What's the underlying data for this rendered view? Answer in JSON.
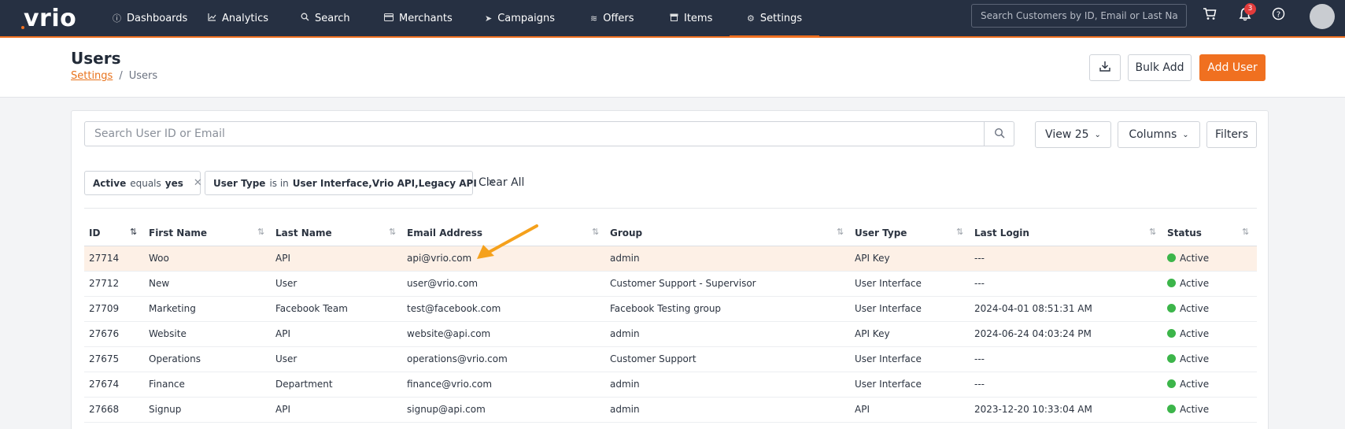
{
  "brand": {
    "logo": "vrio",
    "accent": "#f07020",
    "nav_bg": "#263042",
    "status_active_color": "#3cb54a"
  },
  "nav": [
    {
      "label": "Dashboards",
      "icon": "info-circle-icon"
    },
    {
      "label": "Analytics",
      "icon": "chart-line-icon"
    },
    {
      "label": "Search",
      "icon": "search-icon"
    },
    {
      "label": "Merchants",
      "icon": "credit-card-icon"
    },
    {
      "label": "Campaigns",
      "icon": "paper-plane-icon"
    },
    {
      "label": "Offers",
      "icon": "layers-icon"
    },
    {
      "label": "Items",
      "icon": "box-icon"
    },
    {
      "label": "Settings",
      "icon": "gears-icon",
      "active": true
    }
  ],
  "topbar": {
    "search_placeholder": "Search Customers by ID, Email or Last Name",
    "notification_count": "3",
    "icons": [
      "cart-icon",
      "bell-icon",
      "help-icon",
      "avatar"
    ]
  },
  "page": {
    "title": "Users",
    "breadcrumb": [
      "Settings",
      "/",
      "Users"
    ],
    "actions": {
      "download_icon": "download-icon",
      "bulk_add": "Bulk Add",
      "add_user": "Add User"
    }
  },
  "toolbar": {
    "search_placeholder": "Search User ID or Email",
    "view": "View 25",
    "columns": "Columns",
    "filters": "Filters"
  },
  "filters": [
    {
      "field": "Active",
      "op": "equals",
      "value": "yes"
    },
    {
      "field": "User Type",
      "op": "is in",
      "value": "User Interface,Vrio API,Legacy API"
    }
  ],
  "clear_all": "Clear All",
  "table": {
    "columns": [
      "ID",
      "First Name",
      "Last Name",
      "Email Address",
      "Group",
      "User Type",
      "Last Login",
      "Status"
    ],
    "rows": [
      [
        "27714",
        "Woo",
        "API",
        "api@vrio.com",
        "admin",
        "API Key",
        "---",
        "Active"
      ],
      [
        "27712",
        "New",
        "User",
        "user@vrio.com",
        "Customer Support - Supervisor",
        "User Interface",
        "---",
        "Active"
      ],
      [
        "27709",
        "Marketing",
        "Facebook Team",
        "test@facebook.com",
        "Facebook Testing group",
        "User Interface",
        "2024-04-01 08:51:31 AM",
        "Active"
      ],
      [
        "27676",
        "Website",
        "API",
        "website@api.com",
        "admin",
        "API Key",
        "2024-06-24 04:03:24 PM",
        "Active"
      ],
      [
        "27675",
        "Operations",
        "User",
        "operations@vrio.com",
        "Customer Support",
        "User Interface",
        "---",
        "Active"
      ],
      [
        "27674",
        "Finance",
        "Department",
        "finance@vrio.com",
        "admin",
        "User Interface",
        "---",
        "Active"
      ],
      [
        "27668",
        "Signup",
        "API",
        "signup@api.com",
        "admin",
        "API",
        "2023-12-20 10:33:04 AM",
        "Active"
      ]
    ],
    "highlighted_row_index": 0
  }
}
